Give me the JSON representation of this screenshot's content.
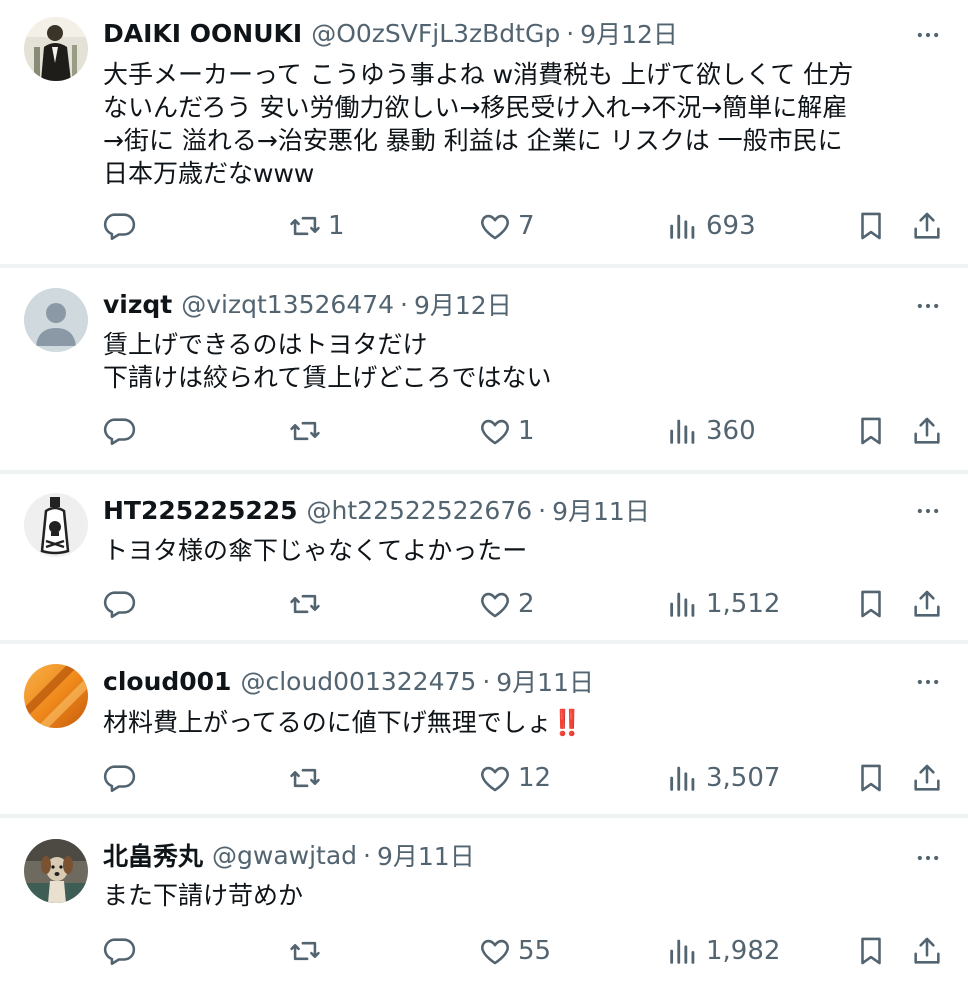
{
  "tweets": [
    {
      "name": "DAIKI OONUKI",
      "handle": "@O0zSVFjL3zBdtGp",
      "separator": "·",
      "date": "9月12日",
      "lines": [
        "大手メーカーって こうゆう事よね w消費税も 上げて欲しくて 仕方",
        "ないんだろう 安い労働力欲しい→移民受け入れ→不況→簡単に解雇",
        "→街に 溢れる→治安悪化 暴動 利益は 企業に リスクは 一般市民に",
        "日本万歳だなwww"
      ],
      "replies": "",
      "retweets": "1",
      "likes": "7",
      "views": "693",
      "avatar_icon": "suited-man-photo-icon"
    },
    {
      "name": "vizqt",
      "handle": "@vizqt13526474",
      "separator": "·",
      "date": "9月12日",
      "lines": [
        "賃上げできるのはトヨタだけ",
        "下請けは絞られて賃上げどころではない"
      ],
      "replies": "",
      "retweets": "",
      "likes": "1",
      "views": "360",
      "avatar_icon": "default-profile-icon"
    },
    {
      "name": "HT225225225",
      "handle": "@ht22522522676",
      "separator": "·",
      "date": "9月11日",
      "lines": [
        "トヨタ様の傘下じゃなくてよかったー"
      ],
      "replies": "",
      "retweets": "",
      "likes": "2",
      "views": "1,512",
      "avatar_icon": "poison-bottle-icon"
    },
    {
      "name": "cloud001",
      "handle": "@cloud001322475",
      "separator": "·",
      "date": "9月11日",
      "lines": [
        "材料費上がってるのに値下げ無理でしょ"
      ],
      "emoji": "‼️",
      "replies": "",
      "retweets": "",
      "likes": "12",
      "views": "3,507",
      "avatar_icon": "orange-gradient-icon"
    },
    {
      "name": "北畠秀丸",
      "handle": "@gwawjtad",
      "separator": "·",
      "date": "9月11日",
      "lines": [
        "また下請け苛めか"
      ],
      "replies": "",
      "retweets": "",
      "likes": "55",
      "views": "1,982",
      "avatar_icon": "dog-photo-icon"
    }
  ],
  "colors": {
    "text": "#0f1419",
    "secondary": "#536471",
    "divider": "#eff3f4",
    "emoji_red": "#d0202a"
  }
}
